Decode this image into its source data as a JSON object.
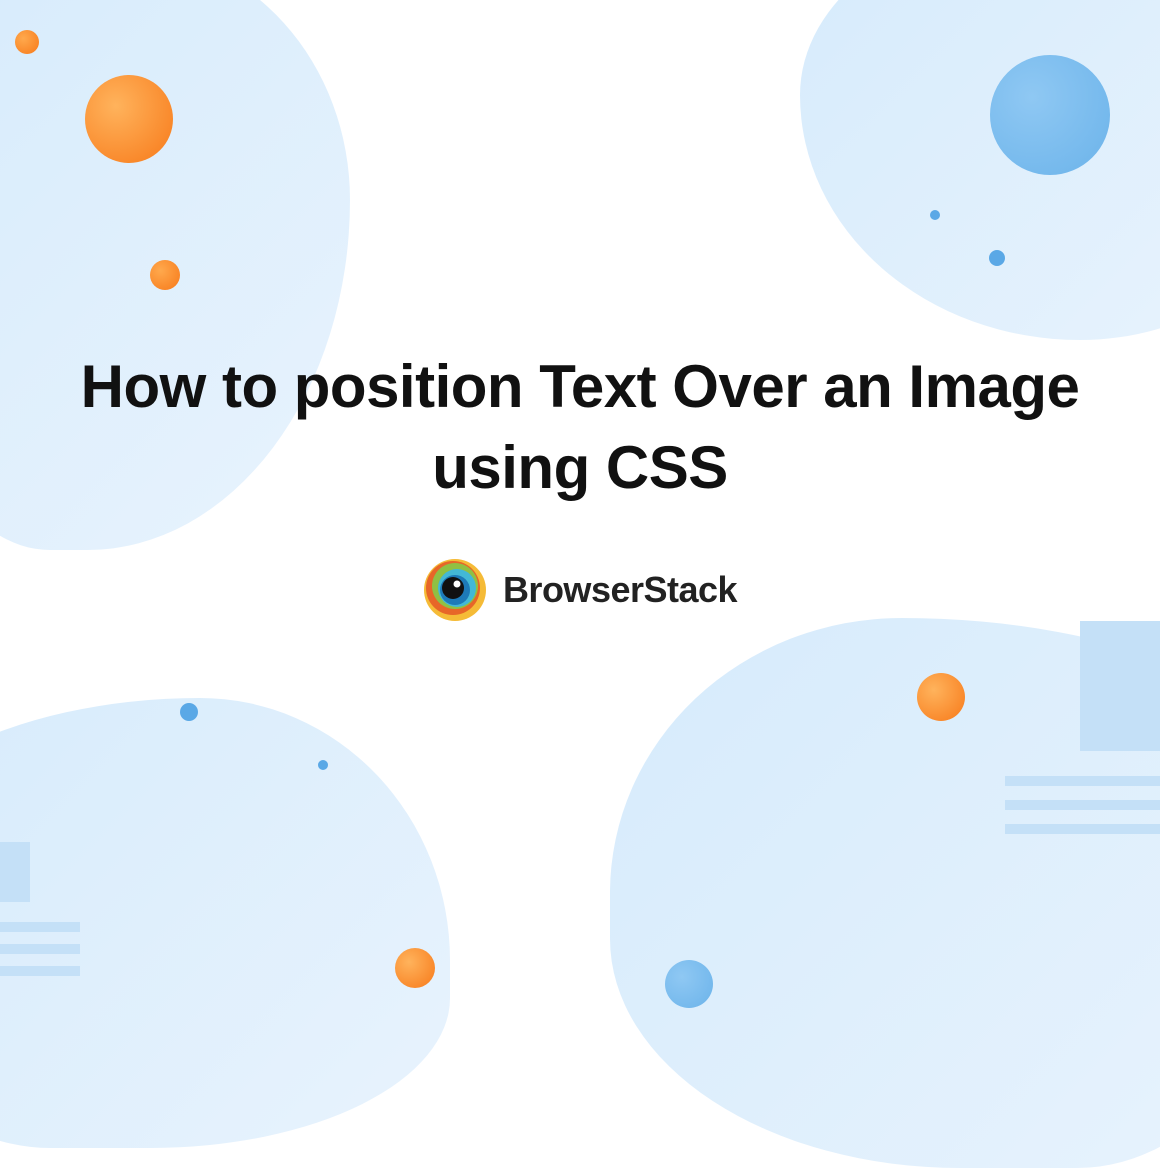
{
  "title": "How to position Text Over an Image using CSS",
  "brand": {
    "name": "BrowserStack"
  },
  "colors": {
    "accent_orange": "#F77919",
    "accent_blue": "#6BB3EA",
    "bg_blue_light": "#D6EBFC",
    "text_dark": "#111111"
  }
}
